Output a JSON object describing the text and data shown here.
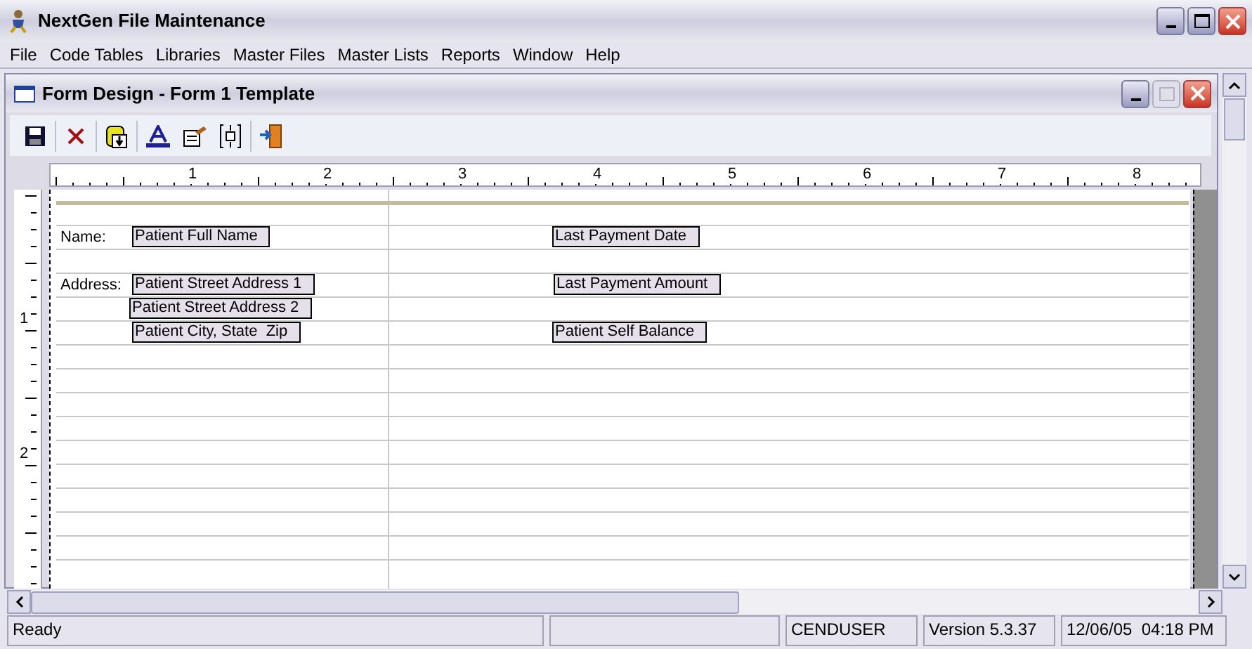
{
  "window": {
    "title": "NextGen File Maintenance"
  },
  "menu": [
    "File",
    "Code Tables",
    "Libraries",
    "Master Files",
    "Master Lists",
    "Reports",
    "Window",
    "Help"
  ],
  "child_window": {
    "title": "Form Design - Form 1 Template"
  },
  "ruler": {
    "horizontal": [
      "1",
      "2",
      "3",
      "4",
      "5",
      "6",
      "7",
      "8"
    ],
    "vertical": [
      "1",
      "2"
    ]
  },
  "form": {
    "rows": [
      {
        "label": "Name:",
        "left_field": "Patient Full Name",
        "right_field": "Last Payment Date"
      },
      {},
      {
        "label": "Address:",
        "left_field": "Patient Street Address 1",
        "right_field": "Last Payment Amount"
      },
      {
        "left_field": "Patient Street Address 2"
      },
      {
        "left_field": "Patient City, State  Zip",
        "right_field": "Patient Self Balance"
      }
    ]
  },
  "status_bar": [
    "Ready",
    "CENDUSER",
    "Version 5.3.37",
    "12/06/05  04:18 PM"
  ]
}
